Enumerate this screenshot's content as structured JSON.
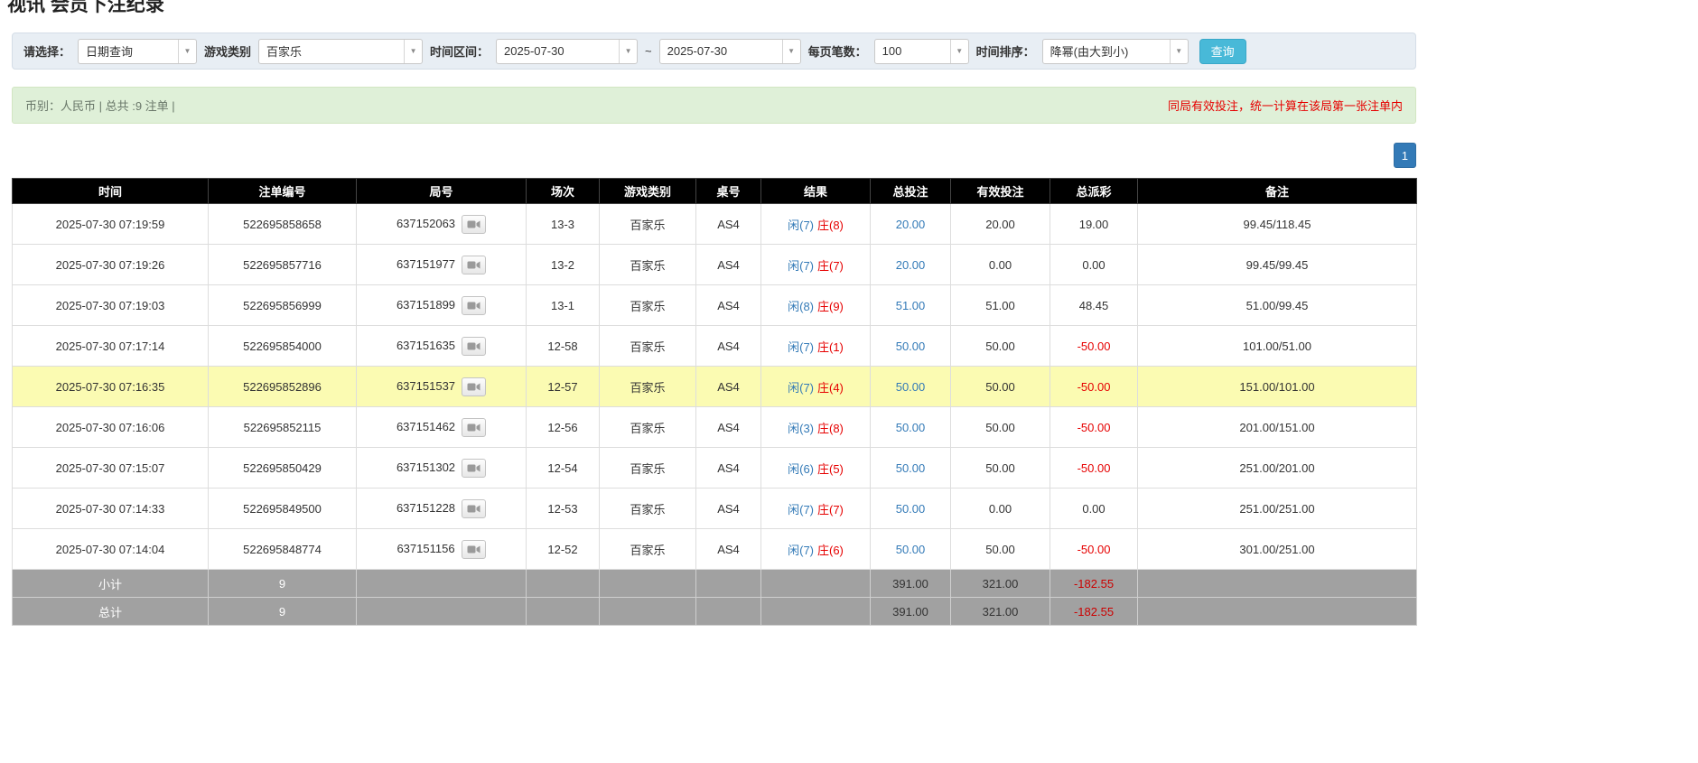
{
  "page": {
    "title": "视讯 会员下注纪录"
  },
  "filters": {
    "select_label": "请选择：",
    "select_value": "日期查询",
    "game_type_label": "游戏类别",
    "game_type_value": "百家乐",
    "time_range_label": "时间区间：",
    "time_from": "2025-07-30",
    "range_separator": "~",
    "time_to": "2025-07-30",
    "page_size_label": "每页笔数：",
    "page_size_value": "100",
    "sort_label": "时间排序：",
    "sort_value": "降幂(由大到小)",
    "query_button": "查询"
  },
  "summary": {
    "currency_info": "币别：人民币 | 总共 :9 注单 |",
    "notice": "同局有效投注，统一计算在该局第一张注单内"
  },
  "pagination": {
    "current_page": "1"
  },
  "table": {
    "headers": [
      "时间",
      "注单编号",
      "局号",
      "场次",
      "游戏类别",
      "桌号",
      "结果",
      "总投注",
      "有效投注",
      "总派彩",
      "备注"
    ],
    "rows": [
      {
        "time": "2025-07-30 07:19:59",
        "bet_id": "522695858658",
        "round_id": "637152063",
        "session": "13-3",
        "game": "百家乐",
        "table_no": "AS4",
        "result_xian": "闲(7)",
        "result_zhuang": "庄(8)",
        "total_bet": "20.00",
        "valid_bet": "20.00",
        "payout": "19.00",
        "note": "99.45/118.45",
        "highlighted": false
      },
      {
        "time": "2025-07-30 07:19:26",
        "bet_id": "522695857716",
        "round_id": "637151977",
        "session": "13-2",
        "game": "百家乐",
        "table_no": "AS4",
        "result_xian": "闲(7)",
        "result_zhuang": "庄(7)",
        "total_bet": "20.00",
        "valid_bet": "0.00",
        "payout": "0.00",
        "note": "99.45/99.45",
        "highlighted": false
      },
      {
        "time": "2025-07-30 07:19:03",
        "bet_id": "522695856999",
        "round_id": "637151899",
        "session": "13-1",
        "game": "百家乐",
        "table_no": "AS4",
        "result_xian": "闲(8)",
        "result_zhuang": "庄(9)",
        "total_bet": "51.00",
        "valid_bet": "51.00",
        "payout": "48.45",
        "note": "51.00/99.45",
        "highlighted": false
      },
      {
        "time": "2025-07-30 07:17:14",
        "bet_id": "522695854000",
        "round_id": "637151635",
        "session": "12-58",
        "game": "百家乐",
        "table_no": "AS4",
        "result_xian": "闲(7)",
        "result_zhuang": "庄(1)",
        "total_bet": "50.00",
        "valid_bet": "50.00",
        "payout": "-50.00",
        "note": "101.00/51.00",
        "highlighted": false
      },
      {
        "time": "2025-07-30 07:16:35",
        "bet_id": "522695852896",
        "round_id": "637151537",
        "session": "12-57",
        "game": "百家乐",
        "table_no": "AS4",
        "result_xian": "闲(7)",
        "result_zhuang": "庄(4)",
        "total_bet": "50.00",
        "valid_bet": "50.00",
        "payout": "-50.00",
        "note": "151.00/101.00",
        "highlighted": true
      },
      {
        "time": "2025-07-30 07:16:06",
        "bet_id": "522695852115",
        "round_id": "637151462",
        "session": "12-56",
        "game": "百家乐",
        "table_no": "AS4",
        "result_xian": "闲(3)",
        "result_zhuang": "庄(8)",
        "total_bet": "50.00",
        "valid_bet": "50.00",
        "payout": "-50.00",
        "note": "201.00/151.00",
        "highlighted": false
      },
      {
        "time": "2025-07-30 07:15:07",
        "bet_id": "522695850429",
        "round_id": "637151302",
        "session": "12-54",
        "game": "百家乐",
        "table_no": "AS4",
        "result_xian": "闲(6)",
        "result_zhuang": "庄(5)",
        "total_bet": "50.00",
        "valid_bet": "50.00",
        "payout": "-50.00",
        "note": "251.00/201.00",
        "highlighted": false
      },
      {
        "time": "2025-07-30 07:14:33",
        "bet_id": "522695849500",
        "round_id": "637151228",
        "session": "12-53",
        "game": "百家乐",
        "table_no": "AS4",
        "result_xian": "闲(7)",
        "result_zhuang": "庄(7)",
        "total_bet": "50.00",
        "valid_bet": "0.00",
        "payout": "0.00",
        "note": "251.00/251.00",
        "highlighted": false
      },
      {
        "time": "2025-07-30 07:14:04",
        "bet_id": "522695848774",
        "round_id": "637151156",
        "session": "12-52",
        "game": "百家乐",
        "table_no": "AS4",
        "result_xian": "闲(7)",
        "result_zhuang": "庄(6)",
        "total_bet": "50.00",
        "valid_bet": "50.00",
        "payout": "-50.00",
        "note": "301.00/251.00",
        "highlighted": false
      }
    ],
    "subtotal": {
      "label": "小计",
      "count": "9",
      "total_bet": "391.00",
      "valid_bet": "321.00",
      "payout": "-182.55"
    },
    "total": {
      "label": "总计",
      "count": "9",
      "total_bet": "391.00",
      "valid_bet": "321.00",
      "payout": "-182.55"
    }
  }
}
